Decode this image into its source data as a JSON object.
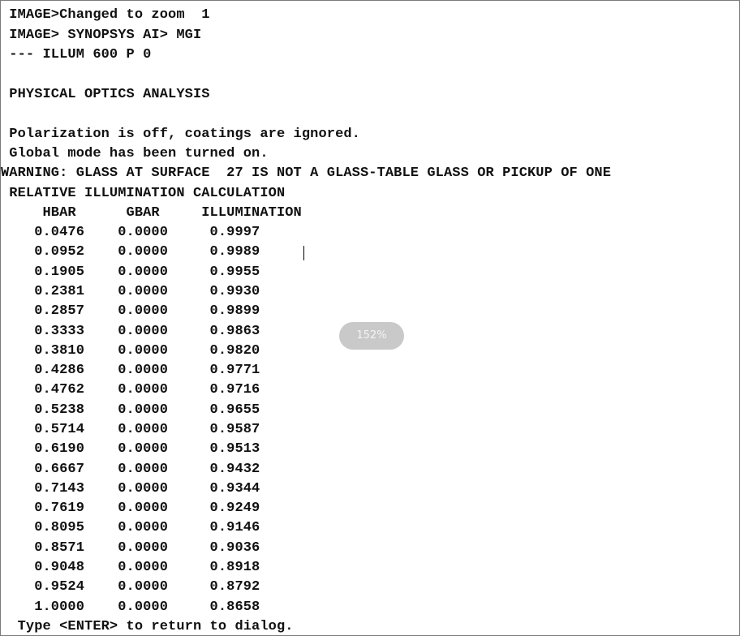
{
  "console": {
    "header_lines": [
      " IMAGE>Changed to zoom  1",
      " IMAGE> SYNOPSYS AI> MGI",
      " --- ILLUM 600 P 0",
      "",
      " PHYSICAL OPTICS ANALYSIS",
      "",
      " Polarization is off, coatings are ignored.",
      " Global mode has been turned on.",
      "WARNING: GLASS AT SURFACE  27 IS NOT A GLASS-TABLE GLASS OR PICKUP OF ONE",
      " RELATIVE ILLUMINATION CALCULATION"
    ],
    "table_header": "     HBAR      GBAR     ILLUMINATION",
    "table_rows": [
      "    0.0476    0.0000     0.9997",
      "    0.0952    0.0000     0.9989",
      "    0.1905    0.0000     0.9955",
      "    0.2381    0.0000     0.9930",
      "    0.2857    0.0000     0.9899",
      "    0.3333    0.0000     0.9863",
      "    0.3810    0.0000     0.9820",
      "    0.4286    0.0000     0.9771",
      "    0.4762    0.0000     0.9716",
      "    0.5238    0.0000     0.9655",
      "    0.5714    0.0000     0.9587",
      "    0.6190    0.0000     0.9513",
      "    0.6667    0.0000     0.9432",
      "    0.7143    0.0000     0.9344",
      "    0.7619    0.0000     0.9249",
      "    0.8095    0.0000     0.9146",
      "    0.8571    0.0000     0.9036",
      "    0.9048    0.0000     0.8918",
      "    0.9524    0.0000     0.8792",
      "    1.0000    0.0000     0.8658"
    ],
    "footer_line": "  Type <ENTER> to return to dialog."
  },
  "zoom_badge": {
    "label": "152%"
  }
}
